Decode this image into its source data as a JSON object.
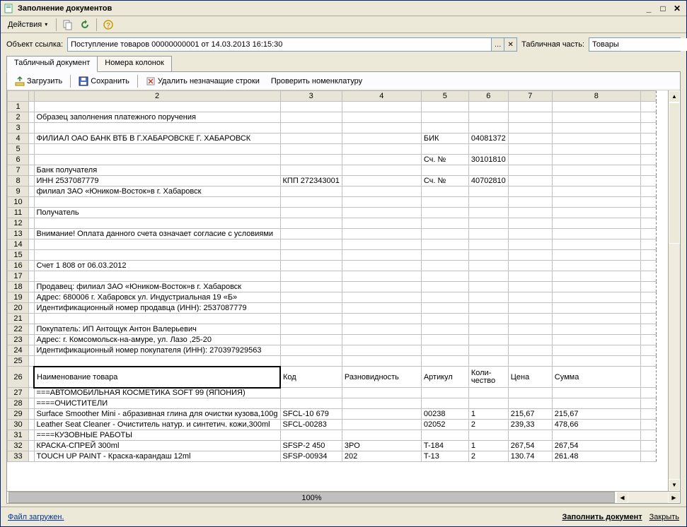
{
  "window": {
    "title": "Заполнение документов"
  },
  "menubar": {
    "actions": "Действия"
  },
  "form": {
    "ref_label": "Объект ссылка:",
    "ref_value": "Поступление товаров 00000000001 от 14.03.2013 16:15:30",
    "table_part_label": "Табличная часть:",
    "table_part_value": "Товары"
  },
  "tabs": {
    "t1": "Табличный документ",
    "t2": "Номера колонок"
  },
  "toolbar": {
    "load": "Загрузить",
    "save": "Сохранить",
    "delete_empty": "Удалить незначащие строки",
    "check": "Проверить номенклатуру"
  },
  "cols": {
    "c3": "3",
    "c4": "4",
    "c5": "5",
    "c6": "6",
    "c7": "7",
    "c8": "8",
    "c2": "2"
  },
  "rows": [
    {
      "n": "1"
    },
    {
      "n": "2",
      "c2": "Образец заполнения платежного поручения"
    },
    {
      "n": "3"
    },
    {
      "n": "4",
      "c2": "ФИЛИАЛ ОАО БАНК ВТБ В Г.ХАБАРОВСКЕ Г. ХАБАРОВСК",
      "c5": "БИК",
      "c6": "04081372"
    },
    {
      "n": "5"
    },
    {
      "n": "6",
      "c5": "Сч. №",
      "c6": "30101810"
    },
    {
      "n": "7",
      "c2": "Банк получателя"
    },
    {
      "n": "8",
      "c2": "ИНН   2537087779",
      "c3": "КПП   272343001",
      "c5": "Сч. №",
      "c6": "40702810"
    },
    {
      "n": "9",
      "c2": "филиал ЗАО «Юником-Восток»в  г. Хабаровск"
    },
    {
      "n": "10"
    },
    {
      "n": "11",
      "c2": "Получатель"
    },
    {
      "n": "12"
    },
    {
      "n": "13",
      "c2": "Внимание! Оплата данного счета означает согласие с условиями"
    },
    {
      "n": "14"
    },
    {
      "n": "15"
    },
    {
      "n": "16",
      "c2": "Счет 1 808 от 06.03.2012"
    },
    {
      "n": "17"
    },
    {
      "n": "18",
      "c2": "Продавец: филиал ЗАО «Юником-Восток»в  г. Хабаровск"
    },
    {
      "n": "19",
      "c2": "Адрес:  680006 г. Хабаровск ул. Индустриальная 19 «Б»"
    },
    {
      "n": "20",
      "c2": "Идентификационный номер продавца (ИНН):  2537087779"
    },
    {
      "n": "21"
    },
    {
      "n": "22",
      "c2": "Покупатель: ИП Антощук Антон Валерьевич"
    },
    {
      "n": "23",
      "c2": "Адрес: г. Комсомольск-на-амуре, ул. Лазо ,25-20"
    },
    {
      "n": "24",
      "c2": "Идентификационный номер покупателя (ИНН): 270397929563"
    },
    {
      "n": "25"
    },
    {
      "n": "26",
      "c2": "Наименование товара",
      "c3": "Код",
      "c4": "Разновидность",
      "c5": "Артикул",
      "c6": "Коли-\nчество",
      "c7": "Цена",
      "c8": "Сумма",
      "hdr": true
    },
    {
      "n": "27",
      "c2": "===АВТОМОБИЛЬНАЯ КОСМЕТИКА SOFT 99 (ЯПОНИЯ)"
    },
    {
      "n": "28",
      "c2": "        ====ОЧИСТИТЕЛИ"
    },
    {
      "n": "29",
      "c2": "Surface Smoother Mini - абразивная глина для очистки кузова,100g",
      "c3": "SFCL-10 679",
      "c5": "00238",
      "c6": "1",
      "c7": "215,67",
      "c8": "215,67"
    },
    {
      "n": "30",
      "c2": "Leather Seat Cleaner - Очиститель натур. и синтетич. кожи,300ml",
      "c3": "SFCL-00283",
      "c5": "02052",
      "c6": "2",
      "c7": "239,33",
      "c8": "478,66"
    },
    {
      "n": "31",
      "c2": "        ====КУЗОВНЫЕ РАБОТЫ"
    },
    {
      "n": "32",
      "c2": "КРАСКА-СПРЕЙ 300ml",
      "c3": "SFSP-2 450",
      "c4": "3PO",
      "c5": "T-184",
      "c6": "1",
      "c7": "267,54",
      "c8": "267,54"
    },
    {
      "n": "33",
      "c2": "TOUCH UP PAINT - Краска-карандаш 12ml",
      "c3": "SFSP-00934",
      "c4": "202",
      "c5": "T-13",
      "c6": "2",
      "c7": "130.74",
      "c8": "261.48"
    }
  ],
  "zoom": "100%",
  "status": {
    "left": "Файл загружен.",
    "fill": "Заполнить документ",
    "close": "Закрыть"
  }
}
